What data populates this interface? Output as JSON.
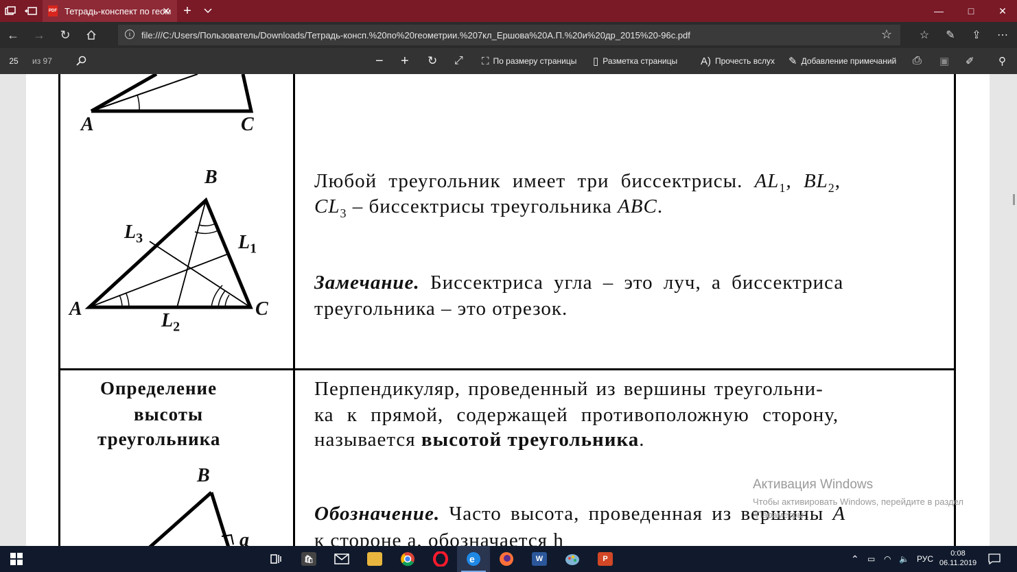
{
  "window": {
    "tab_title": "Тетрадь-конспект по геом",
    "pdf_badge": "PDF",
    "minimize": "—",
    "maximize": "□",
    "close": "✕"
  },
  "navbar": {
    "url": "file:///C:/Users/Пользователь/Downloads/Тетрадь-консп.%20по%20геометрии.%207кл_Ершова%20А.П.%20и%20др_2015%20-96с.pdf"
  },
  "pdf_toolbar": {
    "page_current": "25",
    "page_total": "из 97",
    "fit_page": "По размеру страницы",
    "page_layout": "Разметка страницы",
    "read_aloud": "Прочесть вслух",
    "add_notes": "Добавление примечаний"
  },
  "document": {
    "row1_labels": {
      "A": "A",
      "C": "C"
    },
    "bisector_figure": {
      "B": "B",
      "A": "A",
      "C": "C",
      "L1": "L",
      "L1_sub": "1",
      "L2": "L",
      "L2_sub": "2",
      "L3": "L",
      "L3_sub": "3"
    },
    "bisector_text_1a": "Любой треугольник имеет три биссектрисы.",
    "bisector_text_1b": "AL",
    "bisector_text_1b_sub": "1",
    "bisector_text_1c": ", BL",
    "bisector_text_1c_sub": "2",
    "bisector_text_1d": ",",
    "bisector_text_2a": "CL",
    "bisector_text_2a_sub": "3",
    "bisector_text_2b": " – биссектрисы треугольника ",
    "bisector_text_2c": "ABC",
    "bisector_text_2d": ".",
    "remark_title": "Замечание.",
    "remark_line1": "Биссектриса угла – это луч, а биссектриса",
    "remark_line2": "треугольника – это отрезок.",
    "height_def_title_1": "Определение",
    "height_def_title_2": "высоты",
    "height_def_title_3": "треугольника",
    "height_def_line1": "Перпендикуляр, проведенный из вершины треугольни-",
    "height_def_line2": "ка к прямой, содержащей противоположную сторону,",
    "height_def_line3a": "называется ",
    "height_def_line3b": "высотой треугольника",
    "height_def_line3c": ".",
    "notation_title": "Обозначение.",
    "notation_line1": "Часто высота, проведенная из вершины",
    "notation_line1_var": "A",
    "notation_line2": "к стороне a, обозначается h",
    "height_fig_B": "B",
    "height_fig_a": "a"
  },
  "watermark": {
    "title": "Активация Windows",
    "subtitle": "Чтобы активировать Windows, перейдите в раздел \"Параметры\"."
  },
  "taskbar": {
    "apps": [
      {
        "name": "word-app",
        "label": "W",
        "color": "#2b579a"
      },
      {
        "name": "powerpoint-app",
        "label": "P",
        "color": "#d24726"
      }
    ],
    "language": "РУС",
    "time": "0:08",
    "date": "06.11.2019"
  }
}
